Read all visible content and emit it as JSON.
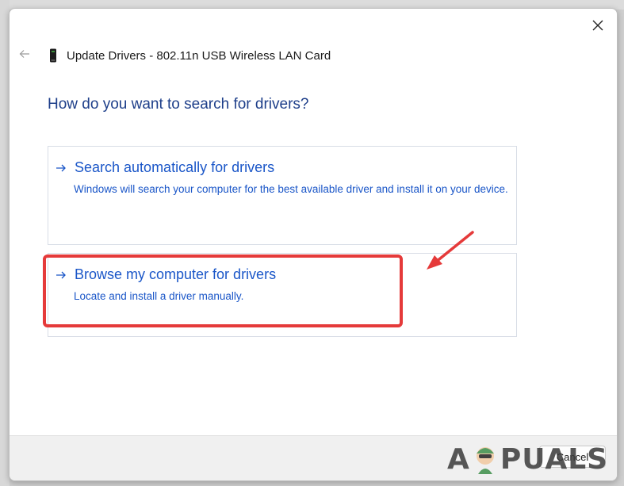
{
  "window": {
    "title": "Update Drivers - 802.11n USB Wireless LAN Card",
    "close_icon": "close-icon",
    "back_icon": "back-arrow-icon",
    "device_icon": "usb-adapter-icon"
  },
  "main": {
    "heading": "How do you want to search for drivers?",
    "options": [
      {
        "title": "Search automatically for drivers",
        "description": "Windows will search your computer for the best available driver and install it on your device.",
        "icon": "arrow-right-icon"
      },
      {
        "title": "Browse my computer for drivers",
        "description": "Locate and install a driver manually.",
        "icon": "arrow-right-icon"
      }
    ]
  },
  "annotation": {
    "highlight_color": "#e53a3a"
  },
  "footer": {
    "cancel_label": "Cancel"
  },
  "watermark": {
    "text_left": "A",
    "text_right": "PUALS"
  },
  "colors": {
    "accent": "#1a56c8",
    "heading": "#1e3f8a"
  }
}
